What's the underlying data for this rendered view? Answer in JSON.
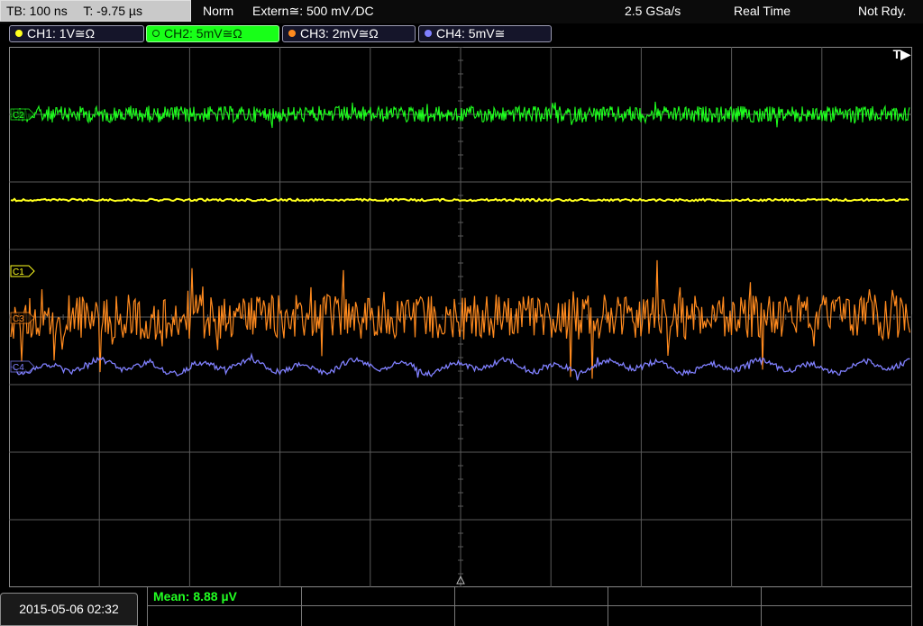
{
  "topbar": {
    "timebase": "TB: 100 ns",
    "trigger_offset": "T: -9.75 µs",
    "mode": "Norm",
    "trigger_source": "Extern≅: 500 mV ⁄DC",
    "sample_rate": "2.5 GSa/s",
    "acq_mode": "Real Time",
    "status": "Not Rdy."
  },
  "channels": [
    {
      "label": "CH1: 1V≅Ω",
      "color": "#ffff1e",
      "active": false
    },
    {
      "label": "CH2: 5mV≅Ω",
      "color": "#1eff1e",
      "active": true
    },
    {
      "label": "CH3: 2mV≅Ω",
      "color": "#ff8a1e",
      "active": false
    },
    {
      "label": "CH4: 5mV≅",
      "color": "#8080ff",
      "active": false
    }
  ],
  "markers": {
    "c1": "C1",
    "c2": "C2",
    "c3": "C3",
    "c4": "C4",
    "trigger": "T▶"
  },
  "bottom": {
    "datetime": "2015-05-06 02:32",
    "mean": "Mean: 8.88 µV"
  },
  "colors": {
    "grid": "#5a5a5a",
    "ch1": "#ffff1e",
    "ch2": "#1eff1e",
    "ch3": "#ff8a1e",
    "ch4": "#8080ff"
  }
}
